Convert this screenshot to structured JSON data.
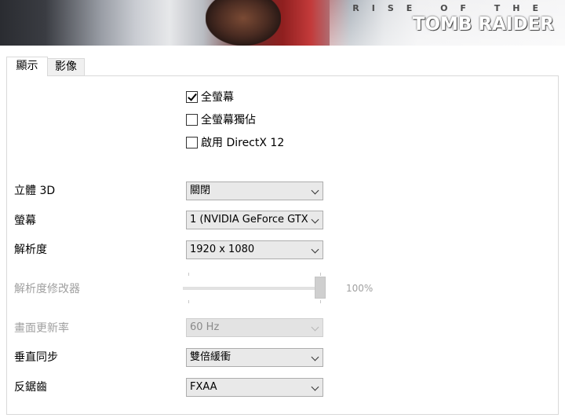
{
  "banner": {
    "logo_top": "RISE OF THE",
    "logo_main": "TOMB RAIDER"
  },
  "tabs": [
    {
      "label": "顯示",
      "active": true
    },
    {
      "label": "影像",
      "active": false
    }
  ],
  "checkboxes": [
    {
      "label": "全螢幕",
      "checked": true
    },
    {
      "label": "全螢幕獨佔",
      "checked": false
    },
    {
      "label": "啟用 DirectX 12",
      "checked": false
    }
  ],
  "settings": {
    "stereo_3d": {
      "label": "立體 3D",
      "value": "關閉"
    },
    "monitor": {
      "label": "螢幕",
      "value": "1 (NVIDIA GeForce GTX"
    },
    "resolution": {
      "label": "解析度",
      "value": "1920 x 1080"
    },
    "resolution_modifier": {
      "label": "解析度修改器",
      "value": "100%",
      "level": 1.0
    },
    "refresh_rate": {
      "label": "畫面更新率",
      "value": "60 Hz"
    },
    "vsync": {
      "label": "垂直同步",
      "value": "雙倍緩衝"
    },
    "antialiasing": {
      "label": "反鋸齒",
      "value": "FXAA"
    }
  },
  "colors": {
    "disabled_text": "#a0a0a0",
    "control_bg": "#e9e9e9"
  }
}
